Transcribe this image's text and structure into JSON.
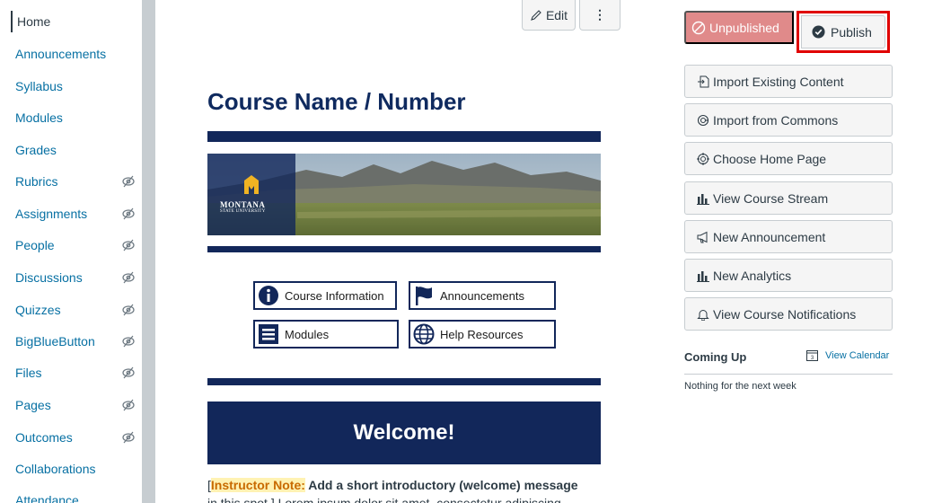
{
  "nav": {
    "items": [
      {
        "label": "Home",
        "hidden": false,
        "active": true
      },
      {
        "label": "Announcements",
        "hidden": false
      },
      {
        "label": "Syllabus",
        "hidden": false
      },
      {
        "label": "Modules",
        "hidden": false
      },
      {
        "label": "Grades",
        "hidden": false
      },
      {
        "label": "Rubrics",
        "hidden": true
      },
      {
        "label": "Assignments",
        "hidden": true
      },
      {
        "label": "People",
        "hidden": true
      },
      {
        "label": "Discussions",
        "hidden": true
      },
      {
        "label": "Quizzes",
        "hidden": true
      },
      {
        "label": "BigBlueButton",
        "hidden": true
      },
      {
        "label": "Files",
        "hidden": true
      },
      {
        "label": "Pages",
        "hidden": true
      },
      {
        "label": "Outcomes",
        "hidden": true
      },
      {
        "label": "Collaborations",
        "hidden": false
      },
      {
        "label": "Attendance",
        "hidden": false
      }
    ]
  },
  "toolbar": {
    "edit_label": "Edit",
    "more_label": "⋮"
  },
  "page": {
    "title": "Course Name / Number",
    "logo": {
      "line1": "MONTANA",
      "line2": "STATE UNIVERSITY"
    },
    "quick_links": {
      "course_info": "Course Information",
      "announcements": "Announcements",
      "modules": "Modules",
      "help": "Help Resources"
    },
    "welcome": "Welcome!",
    "note": {
      "open_bracket": "[",
      "label": "Instructor Note:",
      "text": " Add a short introductory (welcome) message",
      "line2": "in this spot.] Lorem ipsum dolor sit amet, consectetur adipiscing"
    }
  },
  "sidebar": {
    "unpublished_label": "Unpublished",
    "publish_label": "Publish",
    "buttons": {
      "import_existing": "Import Existing Content",
      "import_commons": "Import from Commons",
      "choose_home": "Choose Home Page",
      "course_stream": "View Course Stream",
      "new_announcement": "New Announcement",
      "new_analytics": "New Analytics",
      "notifications": "View Course Notifications"
    },
    "coming_up": "Coming Up",
    "view_calendar": "View Calendar",
    "nothing": "Nothing for the next week"
  },
  "colors": {
    "brand_navy": "#12275a",
    "link": "#0770a3",
    "unpublished": "#e08a8a",
    "highlight_box": "#e00000"
  }
}
